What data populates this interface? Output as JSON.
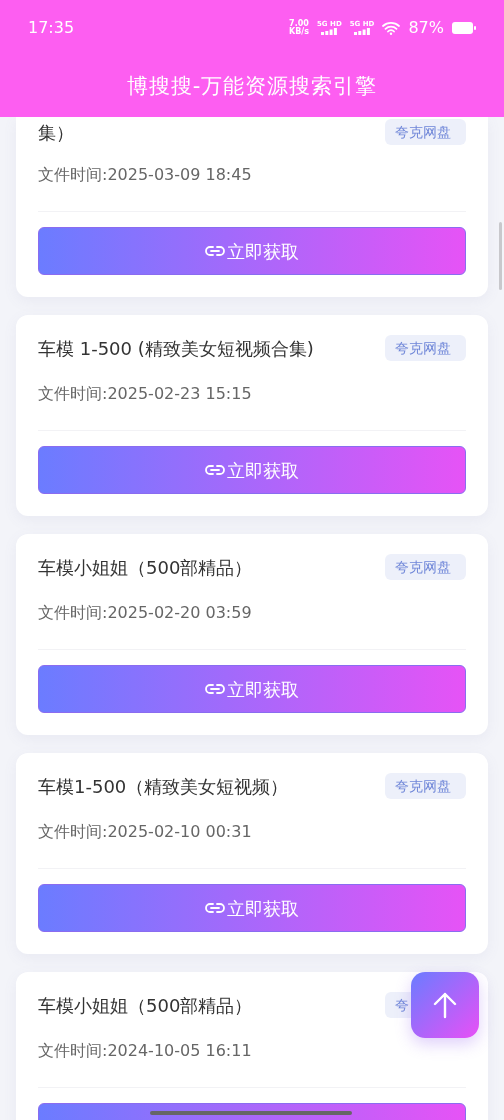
{
  "status_bar": {
    "time": "17:35",
    "net_speed": [
      "7.00",
      "KB/s"
    ],
    "signals": [
      {
        "label": "5G HD"
      },
      {
        "label": "5G HD"
      }
    ],
    "battery": "87%"
  },
  "header": {
    "title": "博搜搜-万能资源搜索引擎"
  },
  "results": [
    {
      "title": "集）",
      "tag": "夸克网盘",
      "time": "文件时间:2025-03-09 18:45",
      "button": "立即获取",
      "cut_top": true
    },
    {
      "title": "车模 1-500 (精致美女短视频合集)",
      "tag": "夸克网盘",
      "time": "文件时间:2025-02-23 15:15",
      "button": "立即获取"
    },
    {
      "title": "车模小姐姐（500部精品）",
      "tag": "夸克网盘",
      "time": "文件时间:2025-02-20 03:59",
      "button": "立即获取"
    },
    {
      "title": "车模1-500（精致美女短视频）",
      "tag": "夸克网盘",
      "time": "文件时间:2025-02-10 00:31",
      "button": "立即获取"
    },
    {
      "title": "车模小姐姐（500部精品）",
      "tag": "夸",
      "time": "文件时间:2024-10-05 16:11"
    }
  ]
}
